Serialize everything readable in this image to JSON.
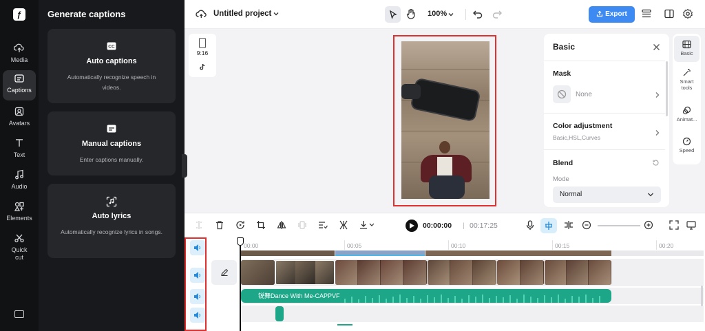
{
  "rail": {
    "items": [
      {
        "label": "Media",
        "icon": "cloud-upload-icon"
      },
      {
        "label": "Captions",
        "icon": "captions-icon"
      },
      {
        "label": "Avatars",
        "icon": "avatar-icon"
      },
      {
        "label": "Text",
        "icon": "text-icon"
      },
      {
        "label": "Audio",
        "icon": "music-note-icon"
      },
      {
        "label": "Elements",
        "icon": "elements-icon"
      },
      {
        "label": "Quick cut",
        "icon": "scissors-icon"
      }
    ],
    "active": "Captions"
  },
  "panel": {
    "title": "Generate captions",
    "cards": [
      {
        "title": "Auto captions",
        "desc": "Automatically recognize speech in videos.",
        "icon": "cc-icon"
      },
      {
        "title": "Manual captions",
        "desc": "Enter captions manually.",
        "icon": "keyboard-caption-icon"
      },
      {
        "title": "Auto lyrics",
        "desc": "Automatically recognize lyrics in songs.",
        "icon": "scan-lyrics-icon"
      }
    ]
  },
  "topbar": {
    "project_name": "Untitled project",
    "zoom": "100%",
    "export_label": "Export"
  },
  "canvas": {
    "ratio_label": "9:16",
    "platform_icon": "tiktok-icon"
  },
  "properties": {
    "header": "Basic",
    "mask_label": "Mask",
    "mask_value": "None",
    "color_label": "Color adjustment",
    "color_sub": "Basic,HSL,Curves",
    "blend_label": "Blend",
    "mode_label": "Mode",
    "mode_value": "Normal"
  },
  "side_tabs": [
    {
      "label": "Basic",
      "icon": "film-icon"
    },
    {
      "label": "Smart tools",
      "icon": "magic-wand-icon"
    },
    {
      "label": "Animat...",
      "icon": "animation-icon"
    },
    {
      "label": "Speed",
      "icon": "speed-icon"
    }
  ],
  "playback": {
    "current": "00:00:00",
    "separator": "|",
    "total": "00:17:25"
  },
  "timeline": {
    "ruler": [
      "00:00",
      "00:05",
      "00:10",
      "00:15",
      "00:20"
    ],
    "audio_track_title": "锐舞Dance With Me-CAPPVF"
  },
  "colors": {
    "accent": "#3d8bf2",
    "audio": "#1ea688",
    "highlight": "#e03030"
  }
}
